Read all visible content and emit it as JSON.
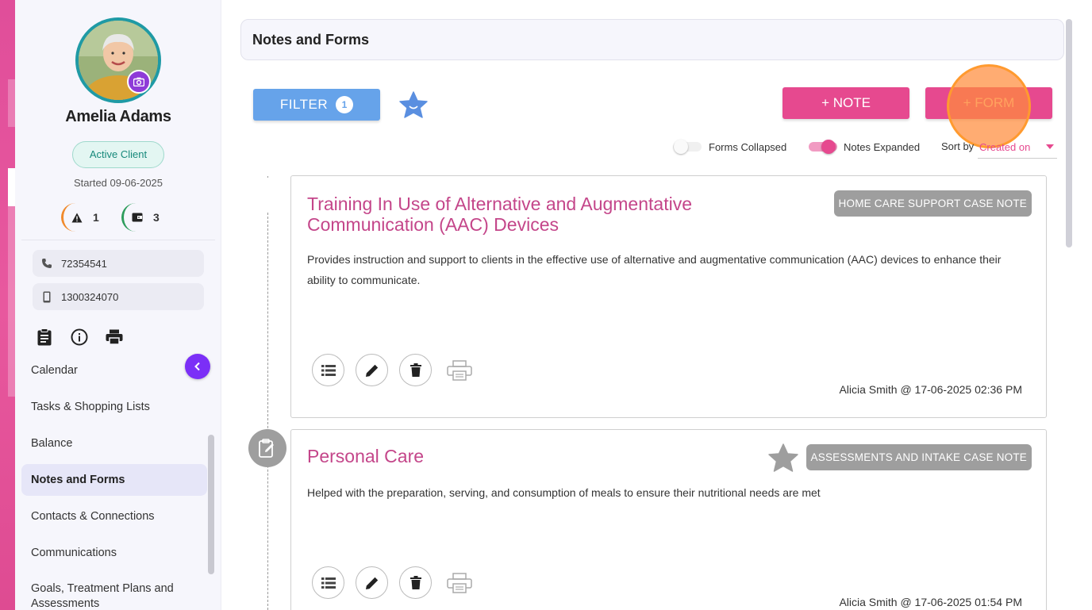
{
  "sidebar": {
    "client_name": "Amelia Adams",
    "status": "Active Client",
    "started": "Started 09-06-2025",
    "stats": [
      {
        "icon": "warning-icon",
        "value": "1",
        "color": "#f08a2c"
      },
      {
        "icon": "wallet-icon",
        "value": "3",
        "color": "#2e9d5c"
      }
    ],
    "contacts": [
      {
        "icon": "phone-icon",
        "value": "72354541"
      },
      {
        "icon": "mobile-icon",
        "value": "1300324070"
      }
    ],
    "nav": [
      "Calendar",
      "Tasks & Shopping Lists",
      "Balance",
      "Notes and Forms",
      "Contacts & Connections",
      "Communications",
      "Goals, Treatment Plans and Assessments"
    ],
    "active_nav": "Notes and Forms"
  },
  "header": {
    "title": "Notes and Forms"
  },
  "toolbar": {
    "filter_label": "FILTER",
    "filter_count": "1",
    "note_button": "+ NOTE",
    "form_button": "+ FORM",
    "forms_toggle_label": "Forms Collapsed",
    "notes_toggle_label": "Notes Expanded",
    "forms_toggle_on": false,
    "notes_toggle_on": true,
    "sort_label": "Sort by",
    "sort_value": "Created on"
  },
  "cards": [
    {
      "title": "Training In Use of Alternative and Augmentative Communication (AAC) Devices",
      "tag": "HOME CARE SUPPORT CASE NOTE",
      "body": "Provides instruction and support to clients in the effective use of alternative and augmentative communication (AAC) devices to enhance their ability to communicate.",
      "meta": "Alicia Smith @ 17-06-2025 02:36 PM"
    },
    {
      "title": "Personal Care",
      "tag": "ASSESSMENTS AND INTAKE CASE NOTE",
      "body": "Helped with the preparation, serving, and consumption of meals to ensure their nutritional needs are met",
      "meta": "Alicia Smith @ 17-06-2025 01:54 PM"
    }
  ],
  "colors": {
    "accent_pink": "#e6498f",
    "title_pink": "#c4468a",
    "filter_blue": "#66a3ea",
    "teal": "#1f9aa5",
    "purple": "#7b2ff7"
  }
}
